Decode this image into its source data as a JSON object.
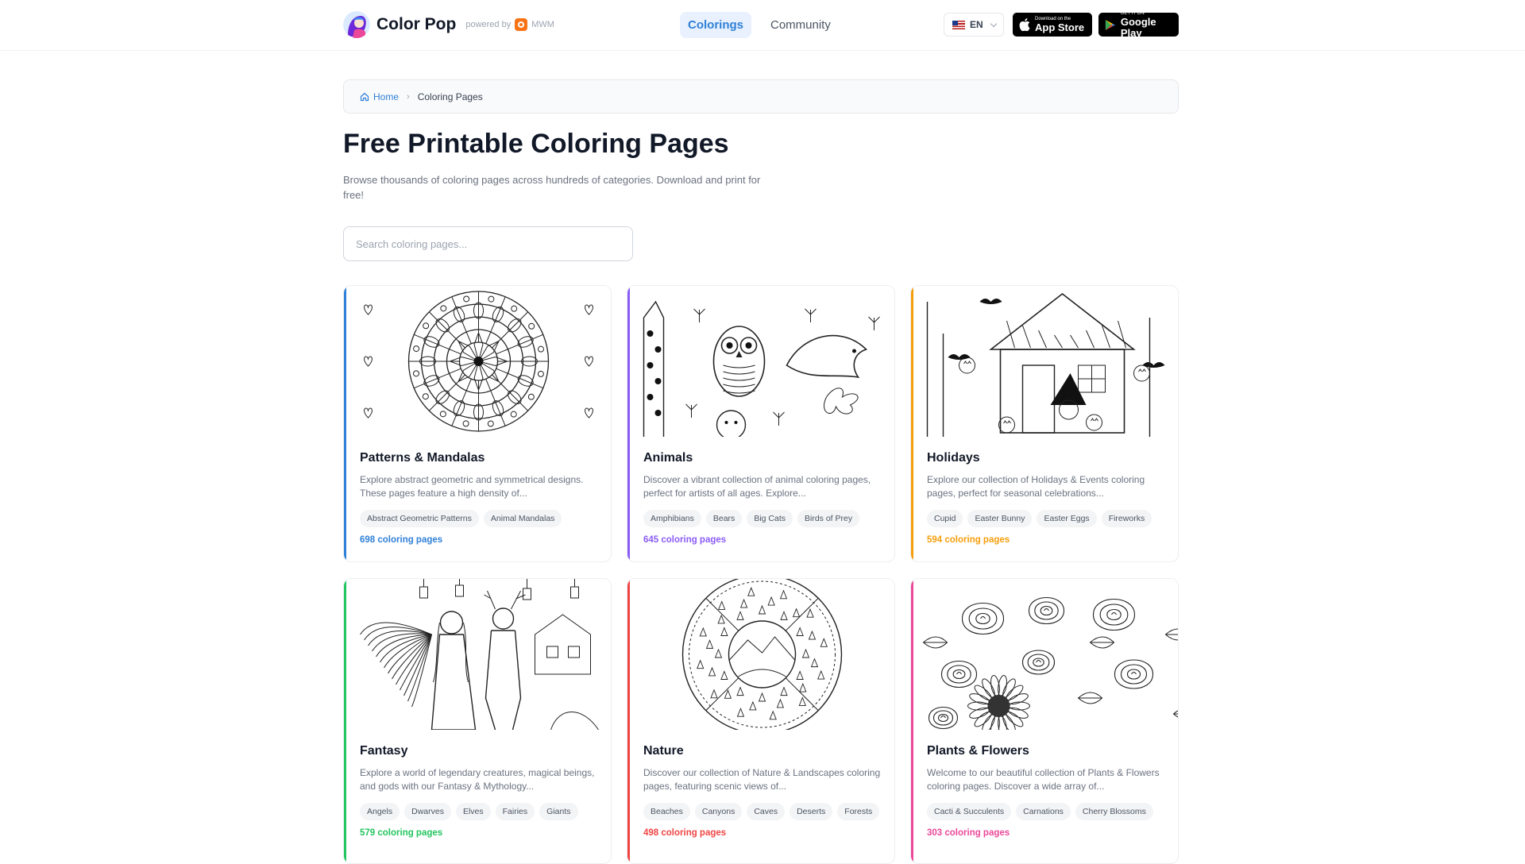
{
  "header": {
    "brand": "Color Pop",
    "powered_by": "powered by",
    "partner": "MWM",
    "nav": [
      {
        "label": "Colorings"
      },
      {
        "label": "Community"
      }
    ],
    "language": "EN",
    "app_store": {
      "small": "Download on the",
      "big": "App Store"
    },
    "google_play": {
      "small": "GET IT ON",
      "big": "Google Play"
    }
  },
  "breadcrumb": {
    "home": "Home",
    "current": "Coloring Pages"
  },
  "hero": {
    "title": "Free Printable Coloring Pages",
    "description": "Browse thousands of coloring pages across hundreds of categories. Download and print for free!"
  },
  "search": {
    "placeholder": "Search coloring pages...",
    "value": ""
  },
  "colors": {
    "accent": "#2f80d8"
  },
  "categories": [
    {
      "title": "Patterns & Mandalas",
      "description": "Explore abstract geometric and symmetrical designs. These pages feature a high density of...",
      "tags": [
        "Abstract Geometric Patterns",
        "Animal Mandalas"
      ],
      "count": "698 coloring pages",
      "color": "#2f80d8",
      "icon": "mandala-image"
    },
    {
      "title": "Animals",
      "description": "Discover a vibrant collection of animal coloring pages, perfect for artists of all ages. Explore...",
      "tags": [
        "Amphibians",
        "Bears",
        "Big Cats",
        "Birds of Prey"
      ],
      "count": "645 coloring pages",
      "color": "#8b5cf6",
      "icon": "animals-image"
    },
    {
      "title": "Holidays",
      "description": "Explore our collection of Holidays & Events coloring pages, perfect for seasonal celebrations...",
      "tags": [
        "Cupid",
        "Easter Bunny",
        "Easter Eggs",
        "Fireworks"
      ],
      "count": "594 coloring pages",
      "color": "#f59e0b",
      "icon": "holidays-image"
    },
    {
      "title": "Fantasy",
      "description": "Explore a world of legendary creatures, magical beings, and gods with our Fantasy & Mythology...",
      "tags": [
        "Angels",
        "Dwarves",
        "Elves",
        "Fairies",
        "Giants"
      ],
      "count": "579 coloring pages",
      "color": "#22c55e",
      "icon": "fantasy-image"
    },
    {
      "title": "Nature",
      "description": "Discover our collection of Nature & Landscapes coloring pages, featuring scenic views of...",
      "tags": [
        "Beaches",
        "Canyons",
        "Caves",
        "Deserts",
        "Forests"
      ],
      "count": "498 coloring pages",
      "color": "#ef4444",
      "icon": "nature-image"
    },
    {
      "title": "Plants & Flowers",
      "description": "Welcome to our beautiful collection of Plants & Flowers coloring pages. Discover a wide array of...",
      "tags": [
        "Cacti & Succulents",
        "Carnations",
        "Cherry Blossoms"
      ],
      "count": "303 coloring pages",
      "color": "#ec4899",
      "icon": "flowers-image"
    }
  ]
}
